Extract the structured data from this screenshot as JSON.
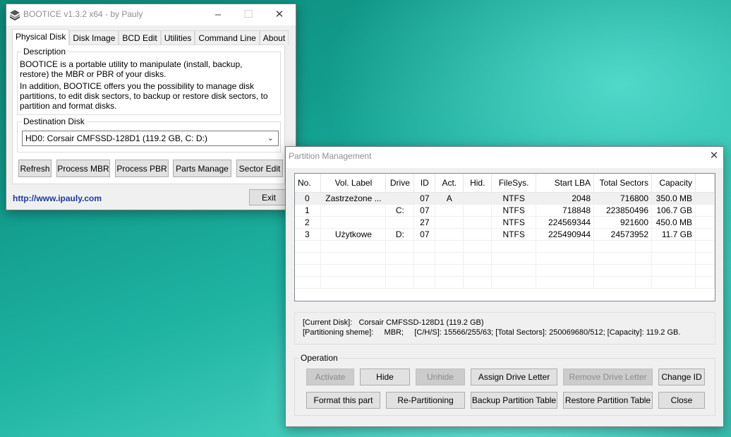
{
  "main_window": {
    "title": "BOOTICE v1.3.2 x64 - by Pauly",
    "tabs": [
      "Physical Disk",
      "Disk Image",
      "BCD Edit",
      "Utilities",
      "Command Line",
      "About"
    ],
    "description": {
      "legend": "Description",
      "para1": "BOOTICE is a portable utility to manipulate (install, backup, restore) the MBR or PBR of your disks.",
      "para2": "In addition, BOOTICE offers you the possibility to manage disk partitions, to edit disk sectors, to backup or restore disk sectors, to partition and format disks."
    },
    "destination": {
      "legend": "Destination Disk",
      "selected": "HD0: Corsair CMFSSD-128D1 (119.2 GB, C: D:)"
    },
    "buttons": {
      "refresh": "Refresh",
      "process_mbr": "Process MBR",
      "process_pbr": "Process PBR",
      "parts_manage": "Parts Manage",
      "sector_edit": "Sector Edit",
      "exit": "Exit"
    },
    "link": "http://www.ipauly.com"
  },
  "partition_window": {
    "title": "Partition Management",
    "columns": [
      "No.",
      "Vol. Label",
      "Drive",
      "ID",
      "Act.",
      "Hid.",
      "FileSys.",
      "Start LBA",
      "Total Sectors",
      "Capacity"
    ],
    "rows": [
      [
        "0",
        "Zastrzeżone ...",
        "",
        "07",
        "A",
        "",
        "NTFS",
        "2048",
        "716800",
        "350.0 MB"
      ],
      [
        "1",
        "",
        "C:",
        "07",
        "",
        "",
        "NTFS",
        "718848",
        "223850496",
        "106.7 GB"
      ],
      [
        "2",
        "",
        "",
        "27",
        "",
        "",
        "NTFS",
        "224569344",
        "921600",
        "450.0 MB"
      ],
      [
        "3",
        "Użytkowe",
        "D:",
        "07",
        "",
        "",
        "NTFS",
        "225490944",
        "24573952",
        "11.7 GB"
      ]
    ],
    "info": {
      "line1": "[Current Disk]:   Corsair CMFSSD-128D1 (119.2 GB)",
      "line2": "[Partitioning sheme]:     MBR;     [C/H/S]: 15566/255/63; [Total Sectors]: 250069680/512; [Capacity]: 119.2 GB."
    },
    "operation": {
      "legend": "Operation",
      "activate": "Activate",
      "hide": "Hide",
      "unhide": "Unhide",
      "assign_drive_letter": "Assign Drive Letter",
      "remove_drive_letter": "Remove Drive Letter",
      "change_id": "Change ID",
      "format_this_part": "Format this part",
      "re_partitioning": "Re-Partitioning",
      "backup_partition_table": "Backup Partition Table",
      "restore_partition_table": "Restore Partition Table",
      "close": "Close"
    }
  }
}
